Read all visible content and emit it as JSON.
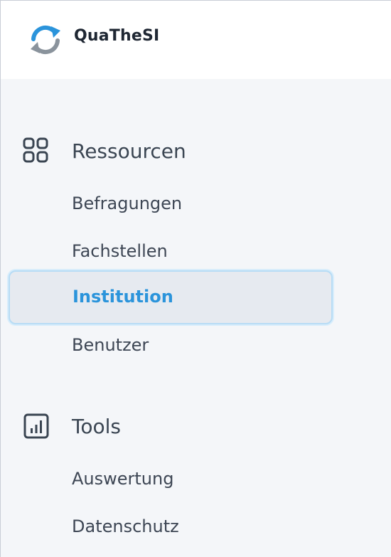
{
  "app": {
    "name": "QuaTheSI",
    "logo_icon": "refresh-logo-icon"
  },
  "colors": {
    "accent": "#2b94db",
    "logo_gray": "#8a939c",
    "text": "#3d4654"
  },
  "sidebar": {
    "sections": [
      {
        "title": "Ressourcen",
        "icon": "grid-icon",
        "items": [
          {
            "label": "Befragungen",
            "active": false
          },
          {
            "label": "Fachstellen",
            "active": false
          },
          {
            "label": "Institution",
            "active": true
          },
          {
            "label": "Benutzer",
            "active": false
          }
        ]
      },
      {
        "title": "Tools",
        "icon": "bar-chart-icon",
        "items": [
          {
            "label": "Auswertung",
            "active": false
          },
          {
            "label": "Datenschutz",
            "active": false
          }
        ]
      }
    ]
  }
}
